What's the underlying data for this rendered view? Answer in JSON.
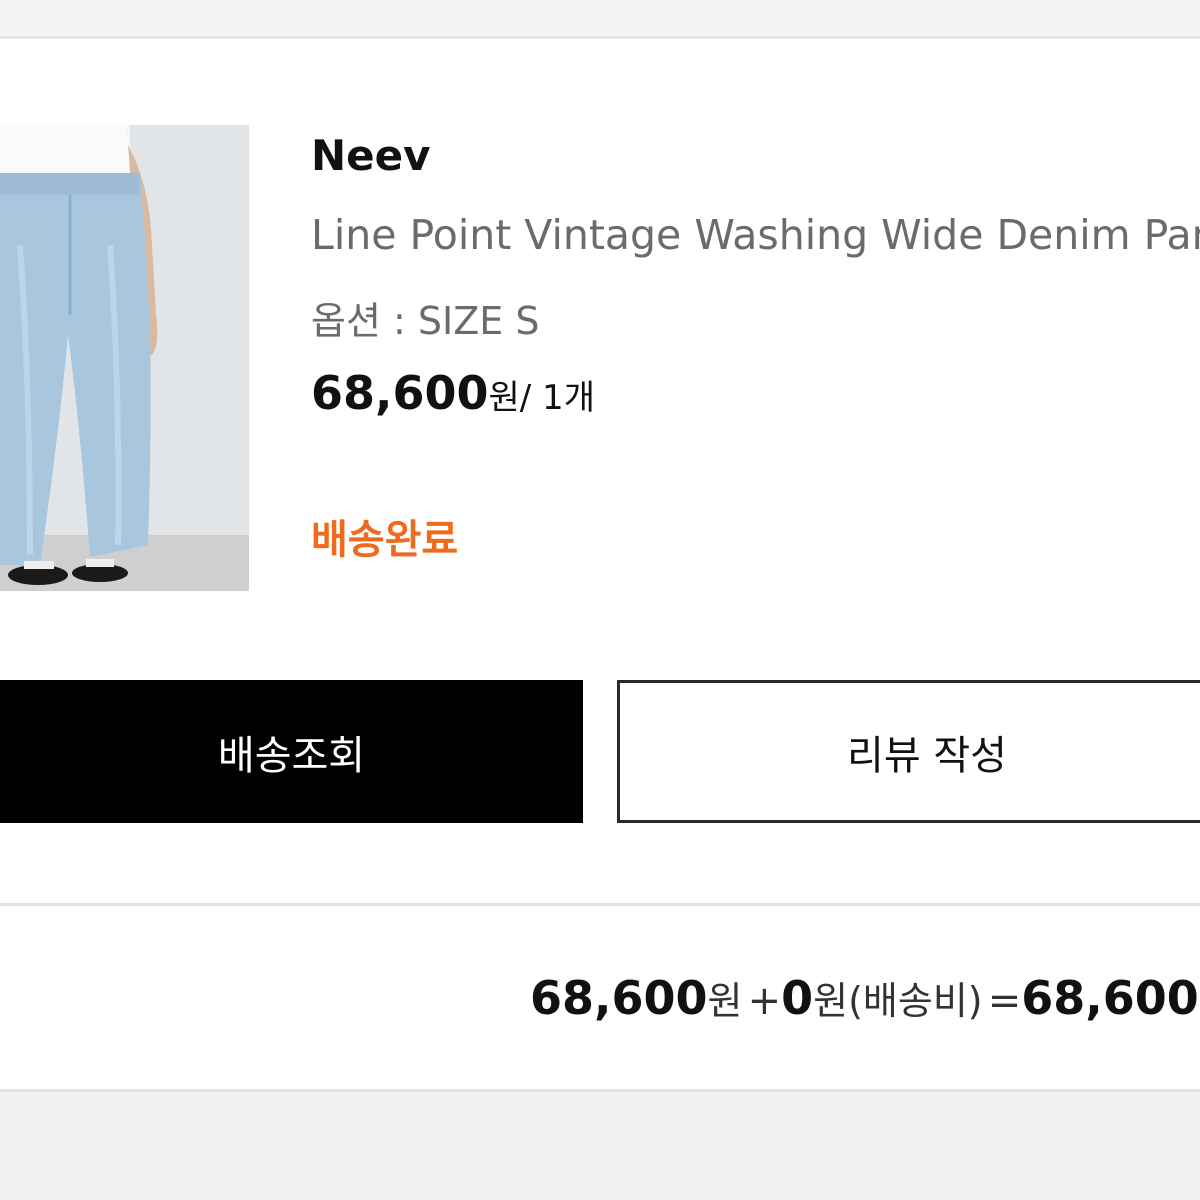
{
  "order_item": {
    "brand": "Neev",
    "product_name": "Line Point Vintage Washing Wide Denim Pants",
    "option": "옵션 : SIZE S",
    "price_amount": "68,600",
    "price_unit": "원",
    "quantity": "/ 1개",
    "status": "배송완료"
  },
  "actions": {
    "track_label": "배송조회",
    "review_label": "리뷰 작성"
  },
  "summary": {
    "subtotal": "68,600",
    "subtotal_unit": "원",
    "plus": "+",
    "shipping": "0",
    "shipping_unit": "원",
    "shipping_label": "(배송비)",
    "equals": "=",
    "total": "68,600"
  },
  "colors": {
    "status": "#ef6a1a",
    "primary_button": "#000000",
    "background": "#f4f4f4"
  }
}
